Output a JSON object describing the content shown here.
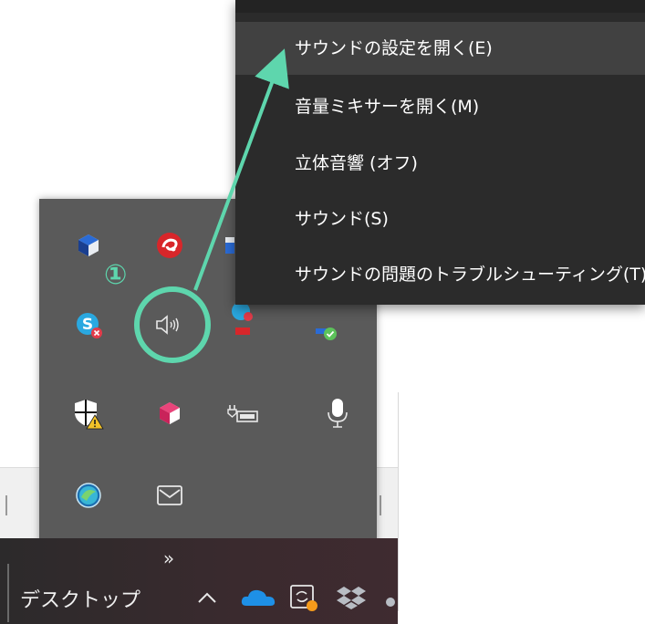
{
  "context_menu": {
    "items": [
      {
        "label": "サウンドの設定を開く(E)",
        "highlighted": true
      },
      {
        "label": "音量ミキサーを開く(M)",
        "highlighted": false
      },
      {
        "label": "立体音響 (オフ)",
        "highlighted": false
      },
      {
        "label": "サウンド(S)",
        "highlighted": false
      },
      {
        "label": "サウンドの問題のトラブルシューティング(T)",
        "highlighted": false
      }
    ]
  },
  "annotation": {
    "step_number": "①",
    "color": "#5ed6ad"
  },
  "tray_popup": {
    "icons": [
      {
        "name": "blue-cube-app-icon"
      },
      {
        "name": "trend-micro-icon"
      },
      {
        "name": "partial-app-icon"
      },
      {
        "name": "skype-icon"
      },
      {
        "name": "speaker-volume-icon"
      },
      {
        "name": "security-shield-warning-icon"
      },
      {
        "name": "pink-cube-app-icon"
      },
      {
        "name": "battery-power-icon"
      },
      {
        "name": "microphone-icon"
      },
      {
        "name": "round-app-icon"
      },
      {
        "name": "mail-icon"
      }
    ]
  },
  "taskbar": {
    "chevron": "»",
    "desktop_label": "デスクトップ",
    "tray_icons": [
      "show-hidden-icons-caret",
      "onedrive-cloud-icon",
      "sync-app-icon",
      "dropbox-icon"
    ]
  },
  "colors": {
    "menu_bg": "#2b2b2b",
    "menu_hover": "#414141",
    "popup_bg": "#5a5a5a",
    "accent": "#5ed6ad"
  }
}
